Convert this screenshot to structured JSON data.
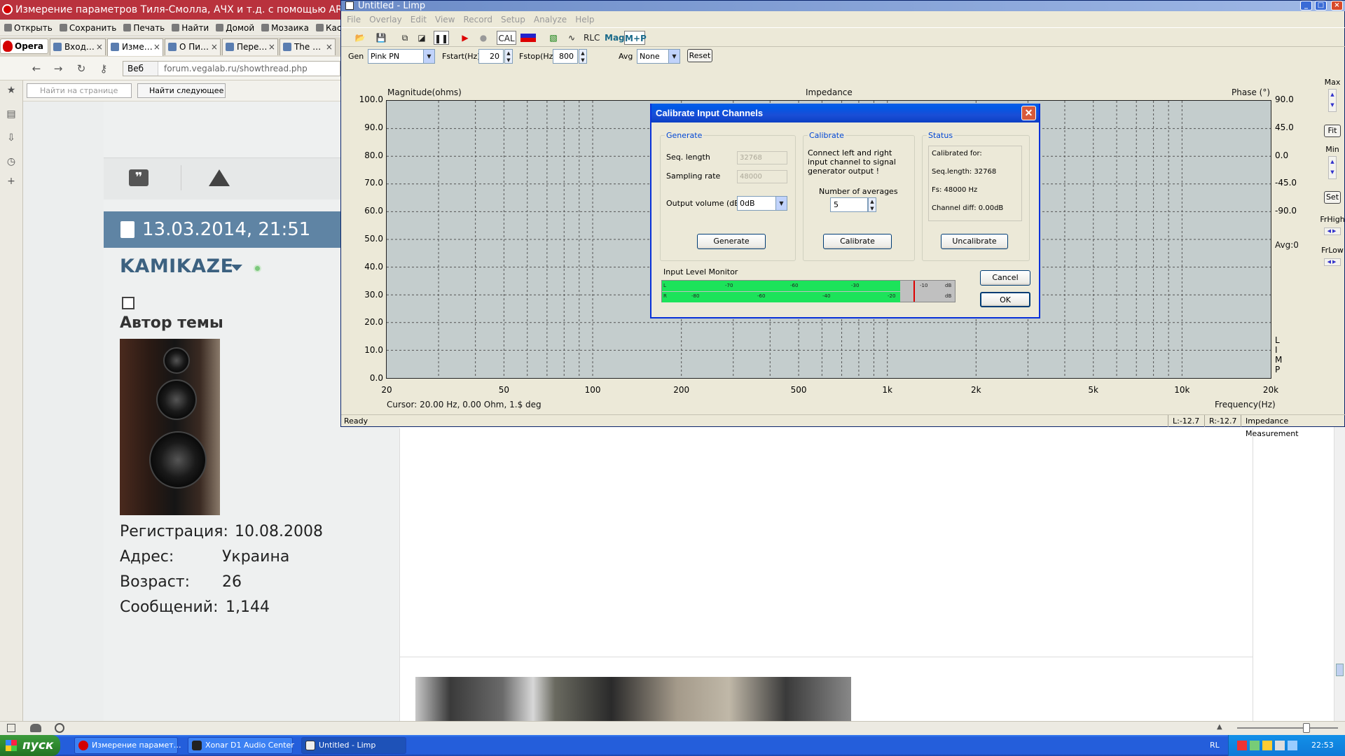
{
  "opera": {
    "title": "Измерение параметров Тиля-Смолла, АЧХ и т.д. с помощью ARTA - Стра",
    "toolbar": [
      "Открыть",
      "Сохранить",
      "Печать",
      "Найти",
      "Домой",
      "Мозаика",
      "Каск"
    ],
    "menu_button": "Opera",
    "tabs": [
      "Вход…",
      "Изме…",
      "О Пи…",
      "Пере…",
      "The …"
    ],
    "url_scheme": "Веб",
    "url": "forum.vegalab.ru/showthread.php",
    "find_placeholder": "Найти на странице",
    "find_next": "Найти следующее"
  },
  "post": {
    "date": "13.03.2014, 21:51",
    "username": "KAMIKAZE",
    "author_label": "Автор темы",
    "stats": [
      {
        "label": "Регистрация:",
        "value": "10.08.2008"
      },
      {
        "label": "Адрес:",
        "value": "Украина"
      },
      {
        "label": "Возраст:",
        "value": "26"
      },
      {
        "label": "Сообщений:",
        "value": "1,144"
      }
    ]
  },
  "limp": {
    "title": "Untitled - Limp",
    "menu": [
      "File",
      "Overlay",
      "Edit",
      "View",
      "Record",
      "Setup",
      "Analyze",
      "Help"
    ],
    "toolbar_text": {
      "cal": "CAL",
      "rlc": "RLC",
      "mag": "Mag",
      "mp": "M+P"
    },
    "params": {
      "gen_label": "Gen",
      "gen_value": "Pink PN",
      "fstart_label": "Fstart(Hz)",
      "fstart_value": "20",
      "fstop_label": "Fstop(Hz)",
      "fstop_value": "800",
      "avg_label": "Avg",
      "avg_value": "None",
      "reset": "Reset"
    },
    "plot": {
      "left_axis_title": "Magnitude(ohms)",
      "center_title": "Impedance",
      "right_axis_title": "Phase (°)",
      "y_left_ticks": [
        "100.0",
        "90.0",
        "80.0",
        "70.0",
        "60.0",
        "50.0",
        "40.0",
        "30.0",
        "20.0",
        "10.0",
        "0.0"
      ],
      "y_right_ticks": [
        "90.0",
        "45.0",
        "0.0",
        "-45.0",
        "-90.0"
      ],
      "avg_label": "Avg:0",
      "x_ticks": [
        "20",
        "50",
        "100",
        "200",
        "500",
        "1k",
        "2k",
        "5k",
        "10k",
        "20k"
      ],
      "cursor": "Cursor: 20.00 Hz, 0.00 Ohm, 1.$ deg",
      "x_axis_title": "Frequency(Hz)",
      "limp_vertical": [
        "L",
        "I",
        "M",
        "P"
      ]
    },
    "right_panel": {
      "max": "Max",
      "fit": "Fit",
      "min": "Min",
      "set": "Set",
      "frhigh": "FrHigh",
      "frlow": "FrLow"
    },
    "status": {
      "ready": "Ready",
      "left": "L:-12.7",
      "right": "R:-12.7",
      "mode": "Impedance Measurement"
    }
  },
  "dialog": {
    "title": "Calibrate Input Channels",
    "generate": {
      "title": "Generate",
      "seq_label": "Seq. length",
      "seq_value": "32768",
      "rate_label": "Sampling rate",
      "rate_value": "48000",
      "vol_label": "Output volume (dB)",
      "vol_value": "0dB",
      "button": "Generate"
    },
    "calibrate": {
      "title": "Calibrate",
      "text": "Connect left and right input channel  to  signal generator output !",
      "avg_label": "Number of averages",
      "avg_value": "5",
      "button": "Calibrate"
    },
    "status": {
      "title": "Status",
      "lines": [
        "Calibrated for:",
        "Seq.length: 32768",
        "Fs: 48000 Hz",
        "Channel diff: 0.00dB"
      ],
      "button": "Uncalibrate"
    },
    "meter_label": "Input Level Monitor",
    "meter_l_marks": [
      "L",
      "-70",
      "-60",
      "-30",
      "-10",
      "dB"
    ],
    "meter_r_marks": [
      "R",
      "-80",
      "-60",
      "-40",
      "-20",
      "dB"
    ],
    "cancel": "Cancel",
    "ok": "OK"
  },
  "taskbar": {
    "start": "пуск",
    "tasks": [
      "Измерение парамет…",
      "Xonar D1 Audio Center",
      "Untitled - Limp"
    ],
    "lang": "RL",
    "clock": "22:53"
  }
}
